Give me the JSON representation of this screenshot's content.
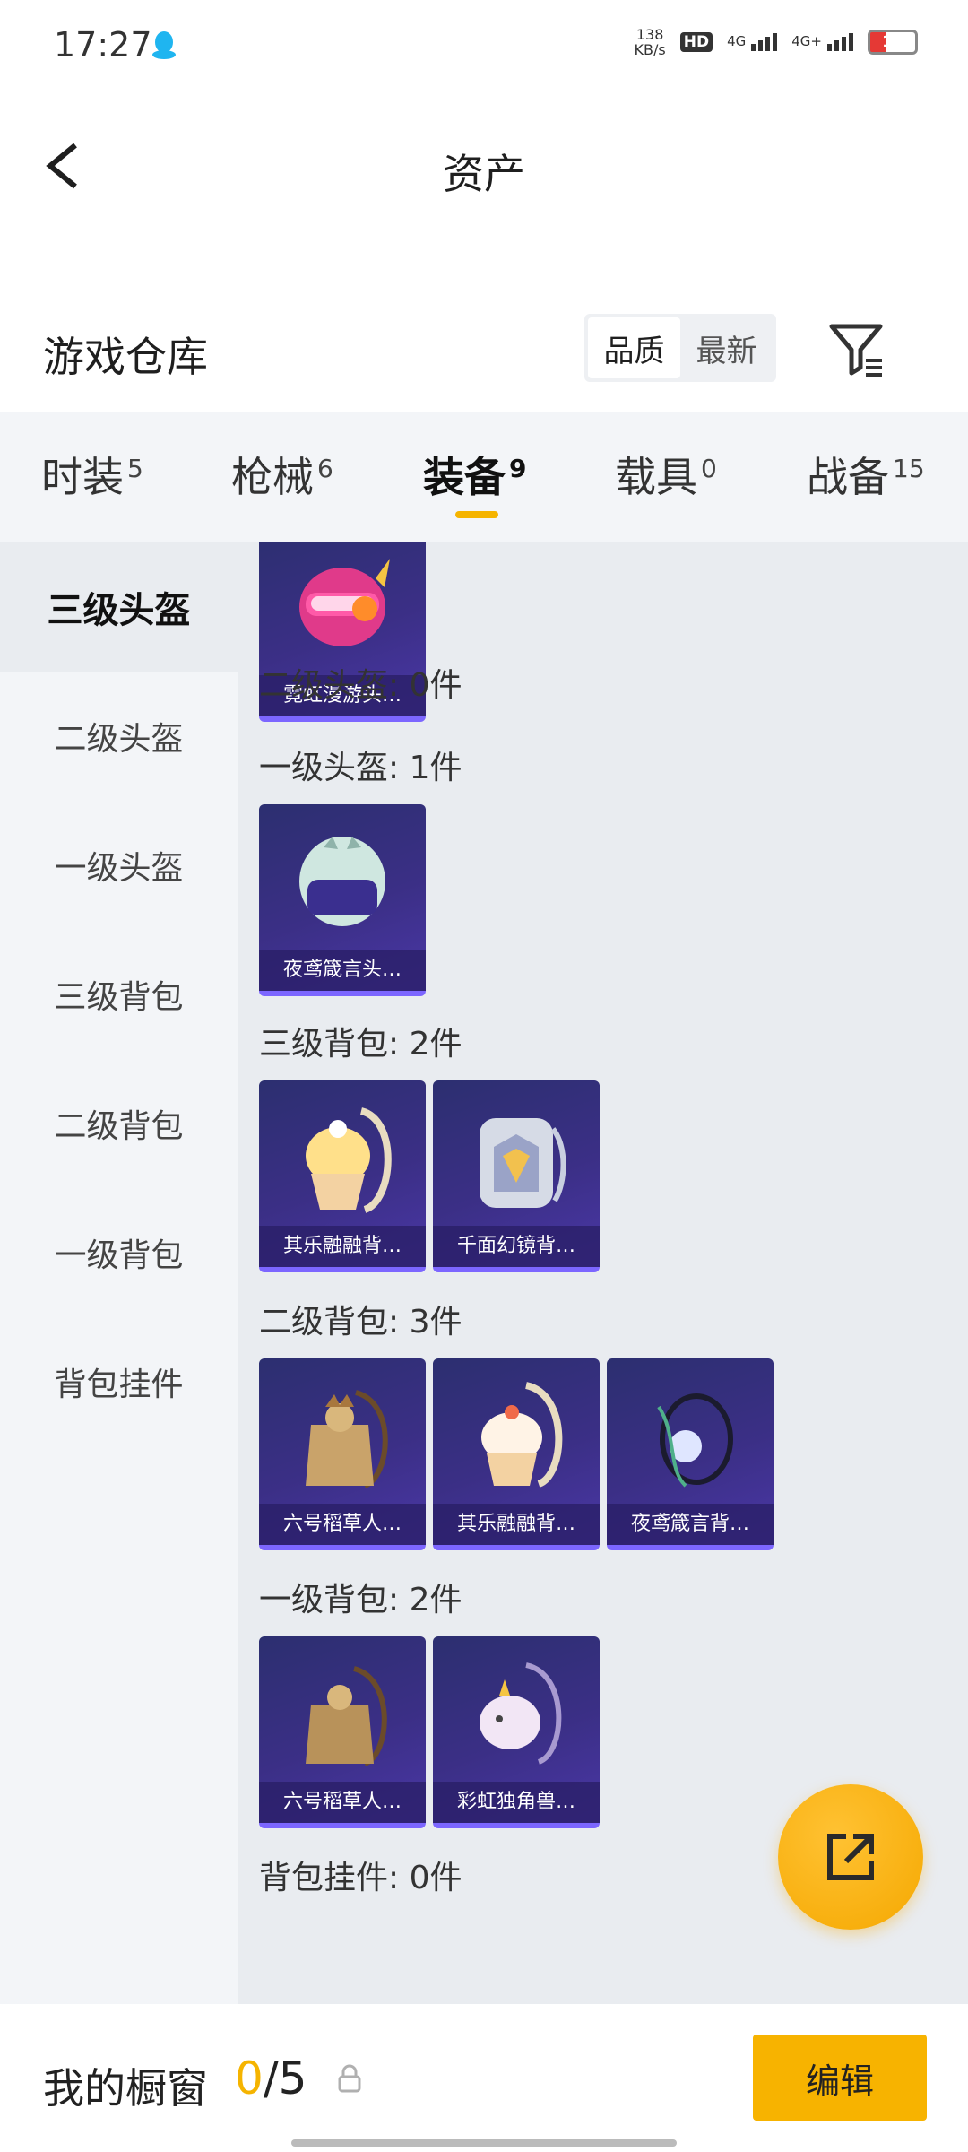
{
  "status_bar": {
    "time": "17:27",
    "net_speed_value": "138",
    "net_speed_unit": "KB/s",
    "hd_label": "HD",
    "sim1_label": "4G",
    "sim2_label": "4G+",
    "battery_level": "17",
    "battery_color": "#e53935"
  },
  "nav": {
    "title": "资产",
    "back_icon": "chevron-left-icon"
  },
  "warehouse": {
    "title": "游戏仓库",
    "sort_options": [
      "品质",
      "最新"
    ],
    "sort_selected": "品质",
    "filter_icon": "filter-icon"
  },
  "tabs": [
    {
      "label": "时装",
      "count": "5"
    },
    {
      "label": "枪械",
      "count": "6"
    },
    {
      "label": "装备",
      "count": "9",
      "active": true
    },
    {
      "label": "载具",
      "count": "0"
    },
    {
      "label": "战备",
      "count": "15"
    }
  ],
  "sidebar": {
    "items": [
      "三级头盔",
      "二级头盔",
      "一级头盔",
      "三级背包",
      "二级背包",
      "一级背包",
      "背包挂件"
    ],
    "active": "三级头盔"
  },
  "sections": [
    {
      "label": "",
      "items": [
        "霓虹漫游头…"
      ]
    },
    {
      "label": "二级头盔: 0件",
      "items": []
    },
    {
      "label": "一级头盔: 1件",
      "items": [
        "夜鸢箴言头…"
      ]
    },
    {
      "label": "三级背包: 2件",
      "items": [
        "其乐融融背…",
        "千面幻镜背…"
      ]
    },
    {
      "label": "二级背包: 3件",
      "items": [
        "六号稻草人…",
        "其乐融融背…",
        "夜鸢箴言背…"
      ]
    },
    {
      "label": "一级背包: 2件",
      "items": [
        "六号稻草人…",
        "彩虹独角兽…"
      ]
    },
    {
      "label": "背包挂件: 0件",
      "items": []
    }
  ],
  "fab": {
    "icon": "share-external-icon"
  },
  "bottom_bar": {
    "title": "我的橱窗",
    "count_current": "0",
    "count_separator": "/",
    "count_total": "5",
    "lock_icon": "lock-icon",
    "edit_label": "编辑"
  },
  "colors": {
    "accent": "#f5b400",
    "card_bg": "#3b2f86",
    "card_border": "#7c66ff"
  }
}
